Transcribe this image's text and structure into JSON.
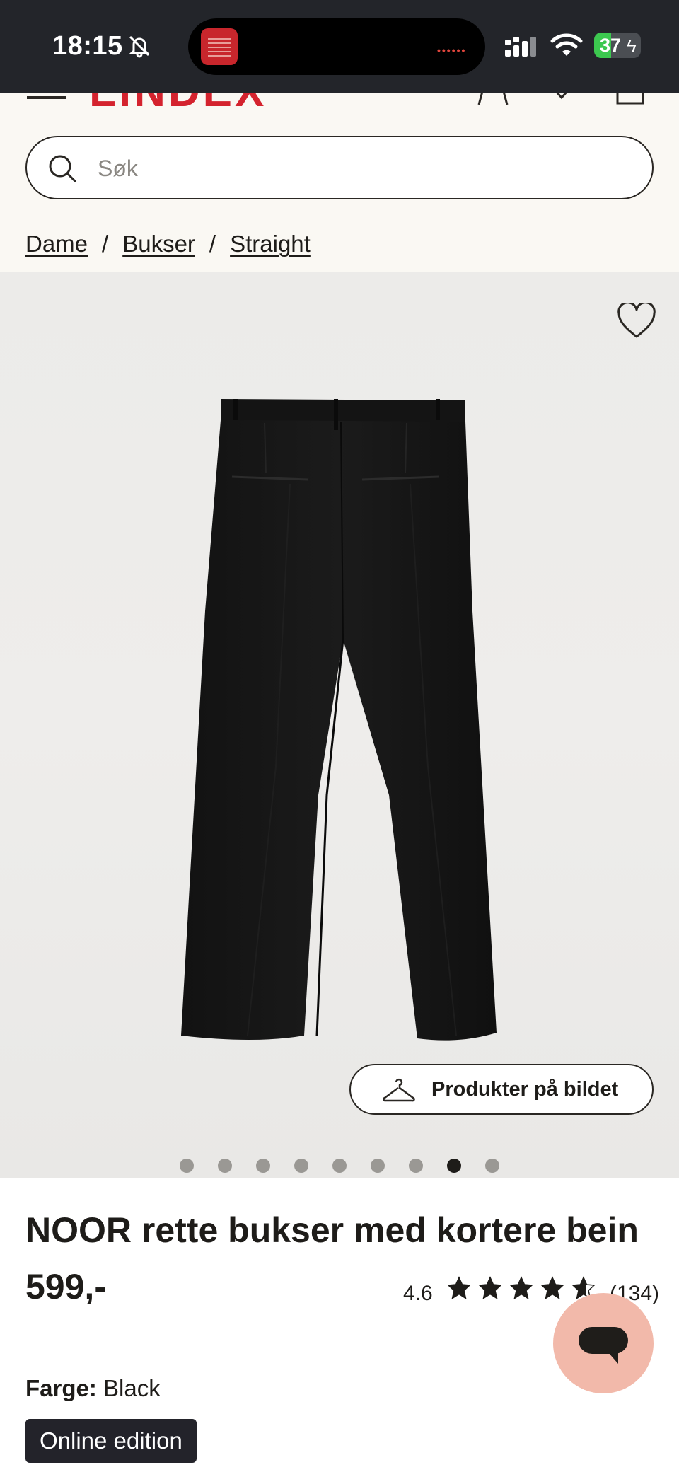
{
  "status_bar": {
    "time": "18:15",
    "battery_level": 37,
    "battery_label": "37",
    "island_dots": "••••••"
  },
  "header": {
    "brand": "LINDEX",
    "search_placeholder": "Søk"
  },
  "breadcrumb": [
    {
      "label": "Dame"
    },
    {
      "label": "Bukser"
    },
    {
      "label": "Straight"
    }
  ],
  "breadcrumb_separator": "/",
  "gallery": {
    "products_in_image_label": "Produkter på bildet",
    "image_count": 9,
    "active_index": 7
  },
  "product": {
    "title": "NOOR rette bukser med kortere bein",
    "price": "599,-",
    "rating": "4.6",
    "rating_value": 4.6,
    "review_count": "(134)",
    "color_label": "Farge:",
    "color_value": "Black",
    "edition_badge": "Online edition"
  },
  "colors": {
    "brand_red": "#d4232e",
    "text": "#1e1c19",
    "chat_button": "#f2b9aa",
    "badge_bg": "#23232a"
  },
  "icons": [
    "bell-muted-icon",
    "signal-icon",
    "wifi-icon",
    "menu-icon",
    "account-icon",
    "heart-icon",
    "bag-icon",
    "search-icon",
    "hanger-icon",
    "star-icon",
    "chat-icon"
  ]
}
